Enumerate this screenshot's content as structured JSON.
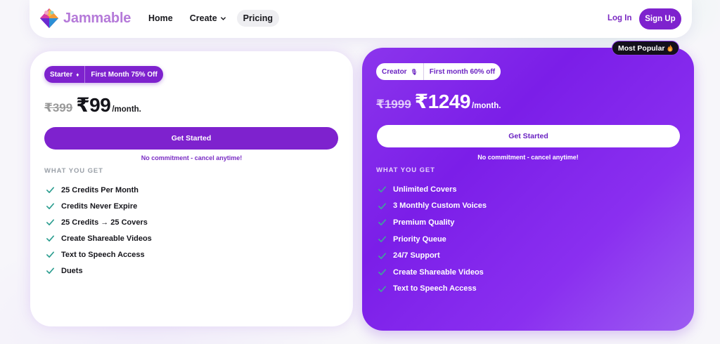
{
  "brand": {
    "name": "Jammable"
  },
  "nav": {
    "links": [
      {
        "label": "Home"
      },
      {
        "label": "Create"
      },
      {
        "label": "Pricing"
      }
    ],
    "login": "Log In",
    "signup": "Sign Up"
  },
  "colors": {
    "accent": "#7e22ce",
    "creator_card": "#8b35ec",
    "check": "#2a9d8f"
  },
  "plans": [
    {
      "name": "Starter",
      "discount": "First Month 75% Off",
      "old_price": "₹399",
      "price": "₹99",
      "period": "/month.",
      "cta": "Get Started",
      "commitment": "No commitment - cancel anytime!",
      "features_heading": "WHAT YOU GET",
      "features": [
        "25 Credits Per Month",
        "Credits Never Expire",
        "25 Credits → 25 Covers",
        "Create Shareable Videos",
        "Text to Speech Access",
        "Duets"
      ]
    },
    {
      "name": "Creator",
      "badge": "Most Popular",
      "discount": "First month 60% off",
      "old_price": "₹1999",
      "price": "₹1249",
      "period": "/month.",
      "cta": "Get Started",
      "commitment": "No commitment - cancel anytime!",
      "features_heading": "WHAT YOU GET",
      "features": [
        "Unlimited Covers",
        "3 Monthly Custom Voices",
        "Premium Quality",
        "Priority Queue",
        "24/7 Support",
        "Create Shareable Videos",
        "Text to Speech Access"
      ]
    }
  ]
}
